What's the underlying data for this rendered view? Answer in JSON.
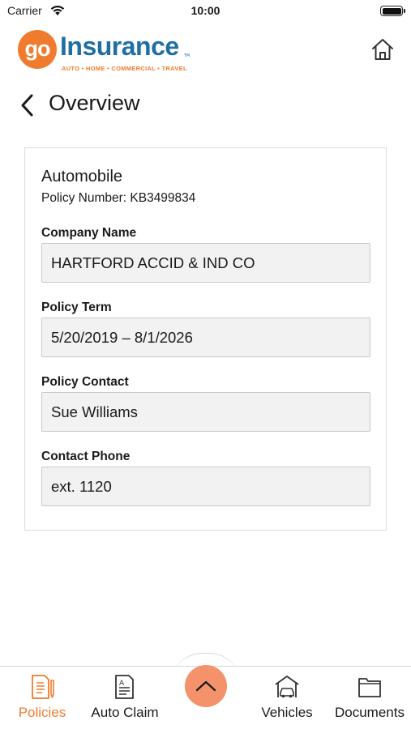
{
  "status_bar": {
    "carrier": "Carrier",
    "time": "10:00"
  },
  "header": {
    "logo": {
      "mark": "go",
      "word": "Insurance",
      "tm": "TM",
      "tagline": "AUTO • HOME • COMMERCIAL • TRAVEL"
    },
    "home_icon": "home-icon"
  },
  "nav": {
    "back_icon": "chevron-left-icon",
    "title": "Overview"
  },
  "policy": {
    "type": "Automobile",
    "number_text": "Policy Number: KB3499834",
    "fields": [
      {
        "label": "Company Name",
        "value": "HARTFORD ACCID & IND CO"
      },
      {
        "label": "Policy Term",
        "value": "5/20/2019 – 8/1/2026"
      },
      {
        "label": "Policy Contact",
        "value": "Sue Williams"
      },
      {
        "label": "Contact Phone",
        "value": "ext. 1120"
      }
    ]
  },
  "tab_bar": {
    "tabs": [
      {
        "label": "Policies",
        "icon": "policies-document-icon",
        "active": true
      },
      {
        "label": "Auto Claim",
        "icon": "auto-claim-form-icon",
        "active": false
      },
      {
        "label": "Vehicles",
        "icon": "car-garage-icon",
        "active": false
      },
      {
        "label": "Documents",
        "icon": "folder-icon",
        "active": false
      }
    ],
    "center_button_icon": "chevron-up-icon"
  },
  "colors": {
    "brand_orange": "#f07b2f",
    "brand_blue": "#1f6fa3",
    "fab": "#f4926b"
  }
}
